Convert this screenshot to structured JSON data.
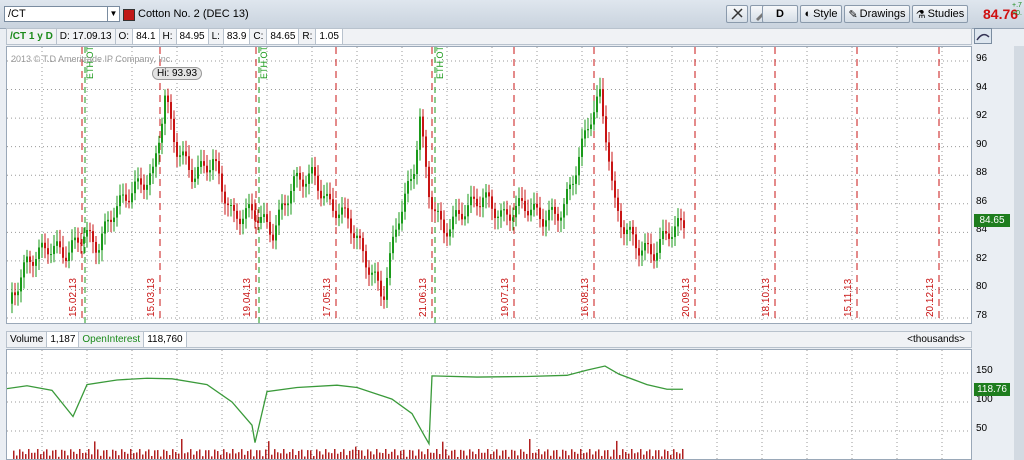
{
  "header": {
    "symbol": "/CT",
    "title": "Cotton No. 2 (DEC 13)",
    "buttons": {
      "d_label": "D",
      "style_label": "Style",
      "drawings_label": "Drawings",
      "studies_label": "Studies"
    },
    "last_price": "84.76",
    "change_line1": "+.7",
    "change_line2": "+0."
  },
  "info": {
    "chart_label": "/CT 1 y D",
    "date_label": "D:",
    "date_value": "17.09.13",
    "open_label": "O:",
    "open_value": "84.1",
    "high_label": "H:",
    "high_value": "84.95",
    "low_label": "L:",
    "low_value": "83.9",
    "close_label": "C:",
    "close_value": "84.65",
    "range_label": "R:",
    "range_value": "1.05"
  },
  "price_chart": {
    "watermark": "2013 © T.D Ameritrade IP Company, Inc.",
    "hi_label": "Hi: 93.93",
    "current_badge": "84.65",
    "y_ticks": [
      "96",
      "94",
      "92",
      "90",
      "88",
      "86",
      "84",
      "82",
      "80",
      "78"
    ],
    "dates": [
      "15.02.13",
      "15.03.13",
      "19.04.13",
      "17.05.13",
      "21.06.13",
      "19.07.13",
      "16.08.13",
      "20.09.13",
      "18.10.13",
      "15.11.13",
      "20.12.13"
    ],
    "expiry_markers": [
      "ETH.OT",
      "ETH.OT",
      "ETH.OT"
    ],
    "colors": {
      "up": "#1a9a1a",
      "down": "#c81414",
      "grid": "#9a9a9a"
    }
  },
  "volume_panel": {
    "volume_label": "Volume",
    "volume_value": "1,187",
    "oi_label": "OpenInterest",
    "oi_value": "118,760",
    "units": "<thousands>",
    "y_ticks": [
      "150",
      "100",
      "50"
    ],
    "current_badge": "118.76"
  }
}
